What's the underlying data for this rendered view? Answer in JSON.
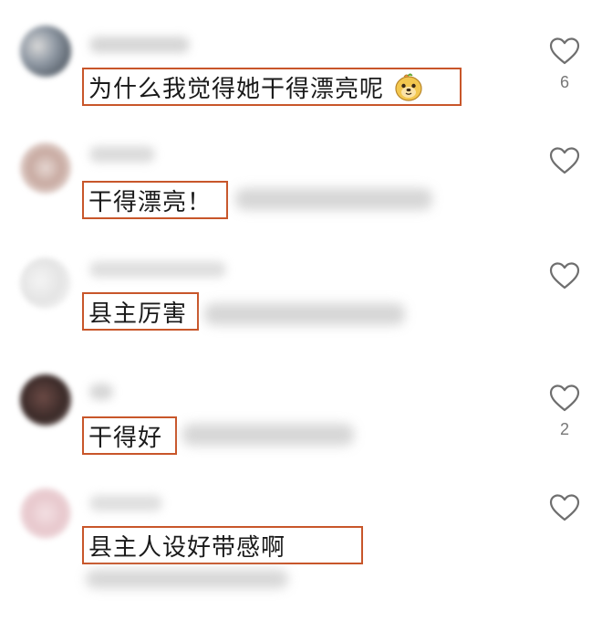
{
  "colors": {
    "highlight_box": "#c8562a",
    "heart_stroke": "#6f6f6f",
    "like_count": "#777777"
  },
  "comments": [
    {
      "text": "为什么我觉得她干得漂亮呢",
      "emoji": "dog-face-emoji",
      "likes": "6"
    },
    {
      "text": "干得漂亮！",
      "likes": ""
    },
    {
      "text": "县主厉害",
      "likes": ""
    },
    {
      "text": "干得好",
      "likes": "2"
    },
    {
      "text": "县主人设好带感啊",
      "likes": ""
    }
  ]
}
